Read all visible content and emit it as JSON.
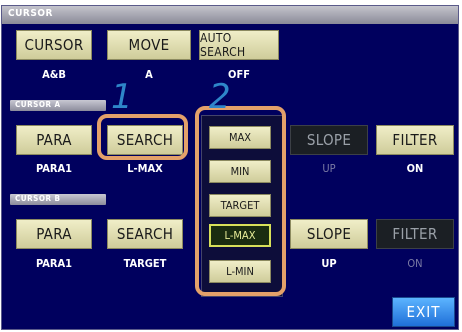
{
  "title": "CURSOR",
  "top_row": {
    "cursor_button": "CURSOR",
    "cursor_value": "A&B",
    "move_button": "MOVE",
    "move_value": "A",
    "auto_search_button": "AUTO SEARCH",
    "auto_search_value": "OFF"
  },
  "cursor_a": {
    "section_label": "CURSOR A",
    "para_button": "PARA",
    "para_value": "PARA1",
    "search_button": "SEARCH",
    "search_value": "L-MAX",
    "slope_button": "SLOPE",
    "slope_value": "UP",
    "filter_button": "FILTER",
    "filter_value": "ON"
  },
  "cursor_b": {
    "section_label": "CURSOR B",
    "para_button": "PARA",
    "para_value": "PARA1",
    "search_button": "SEARCH",
    "search_value": "TARGET",
    "slope_button": "SLOPE",
    "slope_value": "UP",
    "filter_button": "FILTER",
    "filter_value": "ON"
  },
  "search_menu": {
    "options": [
      "MAX",
      "MIN",
      "TARGET",
      "L-MAX",
      "L-MIN"
    ],
    "selected": "L-MAX"
  },
  "callouts": {
    "step1": "1",
    "step2": "2"
  },
  "exit_button": "EXIT",
  "colors": {
    "background": "#00005e",
    "button": "#e6e3b6",
    "button_disabled": "#1b1f24",
    "highlight": "#e3a16a",
    "callout_number": "#2e86c9",
    "exit": "#2a86ec"
  }
}
